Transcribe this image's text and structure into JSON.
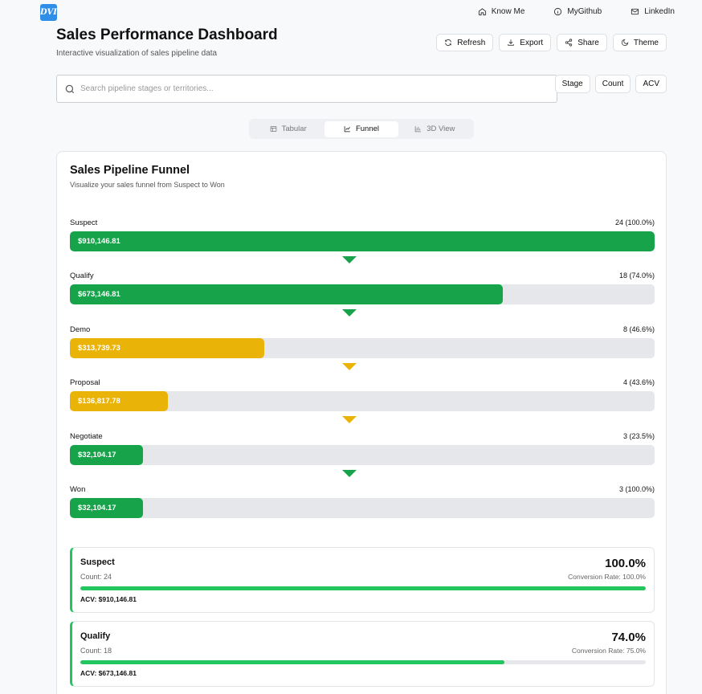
{
  "logo": {
    "text": "DVI"
  },
  "nav": {
    "know_me": "Know Me",
    "github": "MyGithub",
    "linkedin": "LinkedIn"
  },
  "header": {
    "title": "Sales Performance Dashboard",
    "subtitle": "Interactive visualization of sales pipeline data"
  },
  "actions": {
    "refresh": "Refresh",
    "export": "Export",
    "share": "Share",
    "theme": "Theme"
  },
  "search": {
    "placeholder": "Search pipeline stages or territories..."
  },
  "sort": {
    "stage": "Stage",
    "count": "Count",
    "acv": "ACV"
  },
  "tabs": {
    "tabular": "Tabular",
    "funnel": "Funnel",
    "view3d": "3D View",
    "active": "funnel"
  },
  "colors": {
    "green": "#16a34a",
    "yellow": "#eab308",
    "track": "#e5e7eb",
    "accent": "#22c55e"
  },
  "funnel": {
    "title": "Sales Pipeline Funnel",
    "subtitle": "Visualize your sales funnel from Suspect to Won",
    "stages": [
      {
        "name": "Suspect",
        "stat": "24 (100.0%)",
        "acv": "$910,146.81",
        "fill": 1.0,
        "color": "green"
      },
      {
        "name": "Qualify",
        "stat": "18 (74.0%)",
        "acv": "$673,146.81",
        "fill": 0.74,
        "color": "green"
      },
      {
        "name": "Demo",
        "stat": "8 (46.6%)",
        "acv": "$313,739.73",
        "fill": 0.333,
        "color": "yellow"
      },
      {
        "name": "Proposal",
        "stat": "4 (43.6%)",
        "acv": "$136,817.78",
        "fill": 0.167,
        "color": "yellow"
      },
      {
        "name": "Negotiate",
        "stat": "3 (23.5%)",
        "acv": "$32,104.17",
        "fill": 0.125,
        "color": "green"
      },
      {
        "name": "Won",
        "stat": "3 (100.0%)",
        "acv": "$32,104.17",
        "fill": 0.125,
        "color": "green"
      }
    ],
    "arrows": [
      "green",
      "green",
      "yellow",
      "yellow",
      "green"
    ]
  },
  "metrics": [
    {
      "name": "Suspect",
      "count": "Count: 24",
      "percent": "100.0%",
      "conversion": "Conversion Rate: 100.0%",
      "progress": 1.0,
      "acv": "ACV: $910,146.81"
    },
    {
      "name": "Qualify",
      "count": "Count: 18",
      "percent": "74.0%",
      "conversion": "Conversion Rate: 75.0%",
      "progress": 0.75,
      "acv": "ACV: $673,146.81"
    }
  ]
}
